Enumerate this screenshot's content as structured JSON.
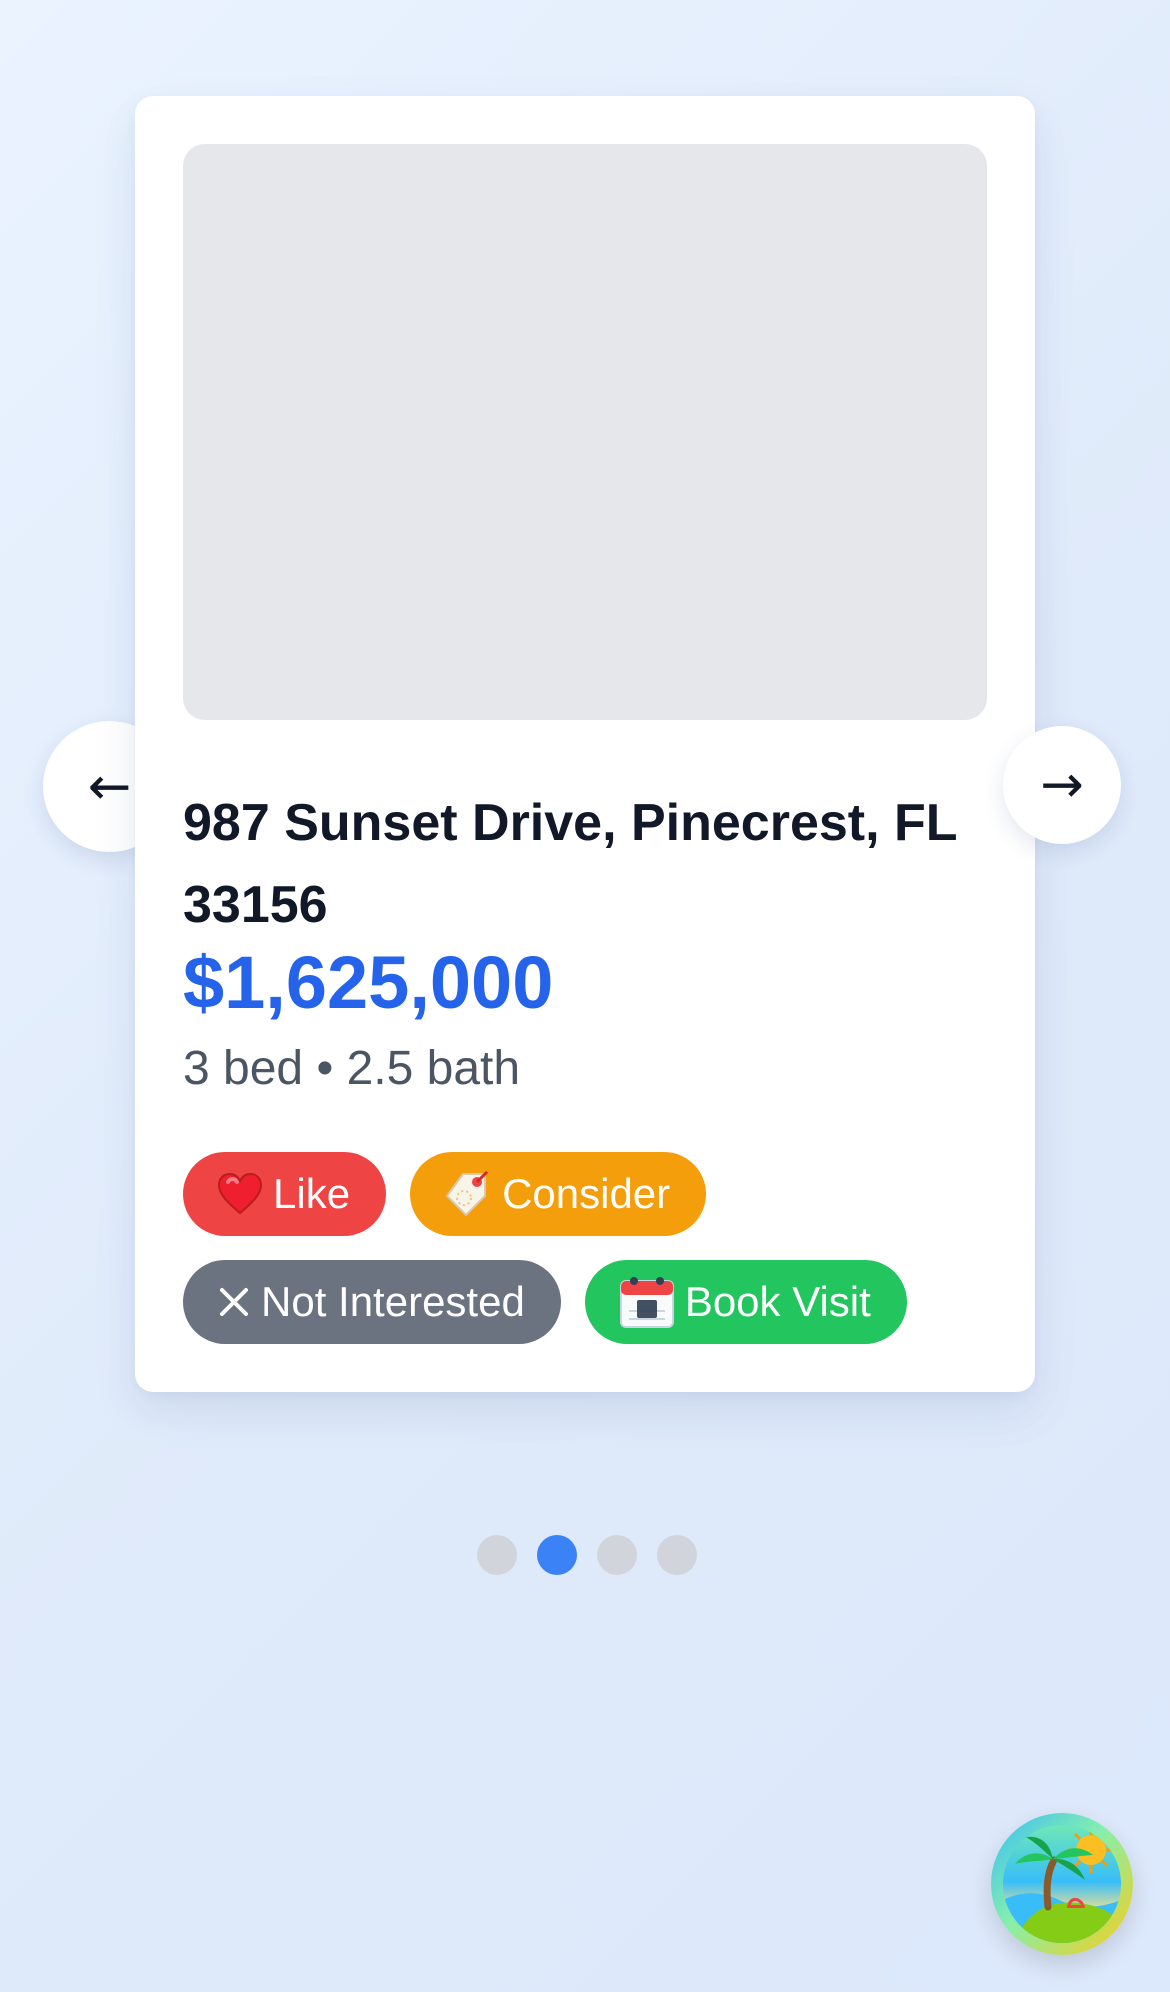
{
  "listing": {
    "address": "987 Sunset Drive, Pinecrest, FL 33156",
    "price": "$1,625,000",
    "details": "3 bed • 2.5 bath"
  },
  "navigation": {
    "prev_symbol": "←",
    "next_symbol": "→"
  },
  "actions": [
    {
      "label": "Like",
      "icon": "heart-icon",
      "glyph": "❤",
      "color": "#ef4444"
    },
    {
      "label": "Consider",
      "icon": "tag-icon",
      "glyph": "🏷",
      "color": "#f59e0b"
    },
    {
      "label": "Not Interested",
      "icon": "x-icon",
      "glyph": "✕",
      "color": "#6b7280"
    },
    {
      "label": "Book Visit",
      "icon": "calendar-icon",
      "glyph": "📅",
      "color": "#22c55e"
    }
  ],
  "carousel": {
    "total": 4,
    "current_index": 1
  },
  "theme": {
    "accent": "#2563eb",
    "active_dot": "#3b82f6",
    "inactive_dot": "#d1d5db"
  },
  "avatar": {
    "icon": "beach-island-icon"
  }
}
